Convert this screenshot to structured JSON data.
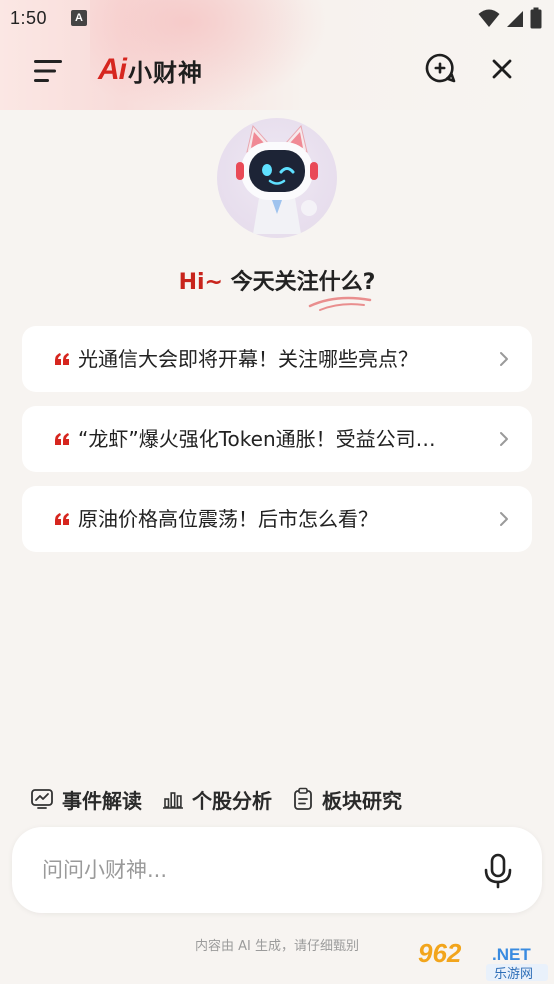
{
  "status_bar": {
    "time": "1:50",
    "notification_glyph": "A",
    "icons": [
      "wifi-icon",
      "signal-icon",
      "battery-icon"
    ]
  },
  "header": {
    "brand_ai": "Ai",
    "brand_name": "小财神",
    "icons": [
      "menu-icon",
      "add-chat-icon",
      "close-icon"
    ]
  },
  "greeting": {
    "hi": "Hi~",
    "question": " 今天关注什么?"
  },
  "suggestions": [
    {
      "text": "光通信大会即将开幕！关注哪些亮点？"
    },
    {
      "text": "“龙虾”爆火强化Token通胀！受益公司…"
    },
    {
      "text": "原油价格高位震荡！后市怎么看？"
    }
  ],
  "quick_actions": [
    {
      "label": "事件解读",
      "icon": "event-chart-icon"
    },
    {
      "label": "个股分析",
      "icon": "bar-chart-icon"
    },
    {
      "label": "板块研究",
      "icon": "clipboard-icon"
    }
  ],
  "input": {
    "placeholder": "问问小财神...",
    "value": ""
  },
  "disclaimer": "内容由 AI 生成，请仔细甄别",
  "watermark": {
    "top": "962",
    "suffix": ".NET",
    "bottom": "乐游网"
  },
  "colors": {
    "accent": "#d6261f",
    "background": "#f7f4f1",
    "card": "#ffffff"
  }
}
